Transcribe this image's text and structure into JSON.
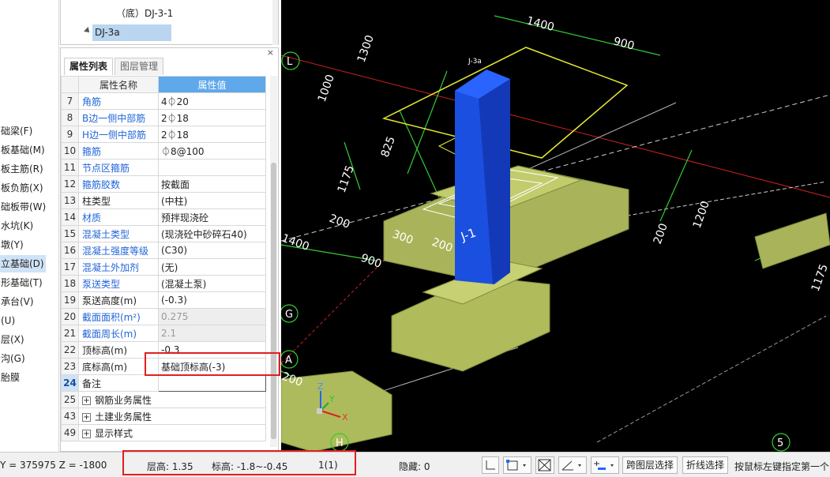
{
  "left_nav": [
    {
      "label": "础梁(F)"
    },
    {
      "label": "板基础(M)"
    },
    {
      "label": "板主筋(R)"
    },
    {
      "label": "板负筋(X)"
    },
    {
      "label": "础板带(W)"
    },
    {
      "label": "水坑(K)"
    },
    {
      "label": "墩(Y)"
    },
    {
      "label": "立基础(D)",
      "active": true
    },
    {
      "label": "形基础(T)"
    },
    {
      "label": "承台(V)"
    },
    {
      "label": "(U)"
    },
    {
      "label": "层(X)"
    },
    {
      "label": "沟(G)"
    },
    {
      "label": "胎膜"
    }
  ],
  "tree": {
    "item1": "（底）DJ-3-1",
    "item2": "DJ-3a"
  },
  "panel": {
    "close": "×",
    "tabs": [
      "属性列表",
      "图层管理"
    ],
    "header_name": "属性名称",
    "header_value": "属性值",
    "rows": [
      {
        "num": "7",
        "name": "角筋",
        "value": "4⏀20",
        "blue": true
      },
      {
        "num": "8",
        "name": "B边一侧中部筋",
        "value": "2⏀18",
        "blue": true
      },
      {
        "num": "9",
        "name": "H边一侧中部筋",
        "value": "2⏀18",
        "blue": true
      },
      {
        "num": "10",
        "name": "箍筋",
        "value": "⏀8@100",
        "blue": true
      },
      {
        "num": "11",
        "name": "节点区箍筋",
        "value": "",
        "blue": true
      },
      {
        "num": "12",
        "name": "箍筋胶数",
        "value": "按截面",
        "blue": true
      },
      {
        "num": "13",
        "name": "柱类型",
        "value": "(中柱)",
        "blue": false
      },
      {
        "num": "14",
        "name": "材质",
        "value": "预拌现浇砼",
        "blue": true
      },
      {
        "num": "15",
        "name": "混凝土类型",
        "value": "(现浇砼中砂碎石40)",
        "blue": true
      },
      {
        "num": "16",
        "name": "混凝土强度等级",
        "value": "(C30)",
        "blue": true
      },
      {
        "num": "17",
        "name": "混凝土外加剂",
        "value": "(无)",
        "blue": true
      },
      {
        "num": "18",
        "name": "泵送类型",
        "value": "(混凝土泵)",
        "blue": true
      },
      {
        "num": "19",
        "name": "泵送高度(m)",
        "value": "(-0.3)",
        "blue": false
      },
      {
        "num": "20",
        "name": "截面面积(m²)",
        "value": "0.275",
        "blue": true,
        "dim": true
      },
      {
        "num": "21",
        "name": "截面周长(m)",
        "value": "2.1",
        "blue": true,
        "dim": true
      },
      {
        "num": "22",
        "name": "顶标高(m)",
        "value": "-0.3",
        "blue": false
      },
      {
        "num": "23",
        "name": "底标高(m)",
        "value": "基础顶标高(-3)",
        "blue": false
      },
      {
        "num": "24",
        "name": "备注",
        "value": "",
        "blue": false,
        "selected": true
      },
      {
        "num": "25",
        "name": "钢筋业务属性",
        "value": "",
        "blue": false,
        "group": true
      },
      {
        "num": "43",
        "name": "土建业务属性",
        "value": "",
        "blue": false,
        "group": true
      },
      {
        "num": "49",
        "name": "显示样式",
        "value": "",
        "blue": false,
        "group": true
      }
    ]
  },
  "viewport": {
    "dims": [
      "1400",
      "900",
      "1300",
      "1000",
      "825",
      "1175",
      "200",
      "300",
      "200",
      "1400",
      "900",
      "1200",
      "200",
      "1175",
      "200",
      "900",
      "400"
    ],
    "labels": [
      "J-3a",
      "J-1"
    ],
    "axis_labels": [
      "L",
      "G",
      "A",
      "H",
      "5"
    ],
    "gizmo": [
      "Z",
      "Y",
      "X"
    ]
  },
  "status": {
    "coord": "Y = 375975 Z = -1800",
    "floor_h": "层高:  1.35",
    "elev": "标高:  -1.8~-0.45",
    "count": "1(1)",
    "hidden": "隐藏:  0",
    "btn_cross": "跨图层选择",
    "btn_poly": "折线选择",
    "hint": "按鼠标左键指定第一个"
  }
}
